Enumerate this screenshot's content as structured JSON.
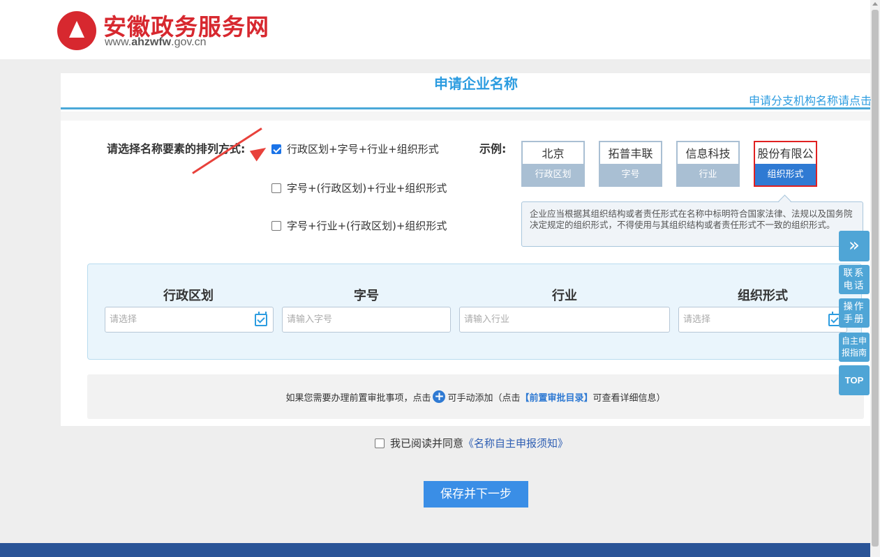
{
  "header": {
    "title": "安徽政务服务网",
    "url_prefix": "www.",
    "url_bold": "ahzwfw",
    "url_suffix": ".gov.cn"
  },
  "card": {
    "title": "申请企业名称",
    "branch_link": "申请分支机构名称请点击"
  },
  "order": {
    "label": "请选择名称要素的排列方式:",
    "options": [
      {
        "label": "行政区划+字号+行业+组织形式",
        "checked": true
      },
      {
        "label": "字号+(行政区划)+行业+组织形式",
        "checked": false
      },
      {
        "label": "字号+行业+(行政区划)+组织形式",
        "checked": false
      }
    ]
  },
  "example": {
    "label": "示例:",
    "items": [
      {
        "value": "北京",
        "caption": "行政区划"
      },
      {
        "value": "拓普丰联",
        "caption": "字号"
      },
      {
        "value": "信息科技",
        "caption": "行业"
      },
      {
        "value": "股份有限公",
        "caption": "组织形式"
      }
    ],
    "tip": "企业应当根据其组织结构或者责任形式在名称中标明符合国家法律、法规以及国务院决定规定的组织形式，不得使用与其组织结构或者责任形式不一致的组织形式。"
  },
  "fields": [
    {
      "label": "行政区划",
      "placeholder": "请选择",
      "type": "select"
    },
    {
      "label": "字号",
      "placeholder": "请输入字号",
      "type": "text"
    },
    {
      "label": "行业",
      "placeholder": "请输入行业",
      "type": "text"
    },
    {
      "label": "组织形式",
      "placeholder": "请选择",
      "type": "select"
    }
  ],
  "prereq": {
    "text_before": "如果您需要办理前置审批事项，点击",
    "text_after": "可手动添加（点击",
    "link": "【前置审批目录】",
    "text_end": "可查看详细信息）"
  },
  "agree": {
    "text": "我已阅读并同意",
    "notice": "《名称自主申报须知》",
    "checked": false
  },
  "save_button": "保存并下一步",
  "side_toolbar": {
    "expand": "»",
    "contact": "联系电话",
    "manual": "操作手册",
    "guide": "自主申报指南",
    "top": "TOP"
  },
  "colors": {
    "brand_red": "#d7282f",
    "accent_blue": "#2c9ce0",
    "button_blue": "#3a8ee6",
    "footer_blue": "#2a5497"
  }
}
